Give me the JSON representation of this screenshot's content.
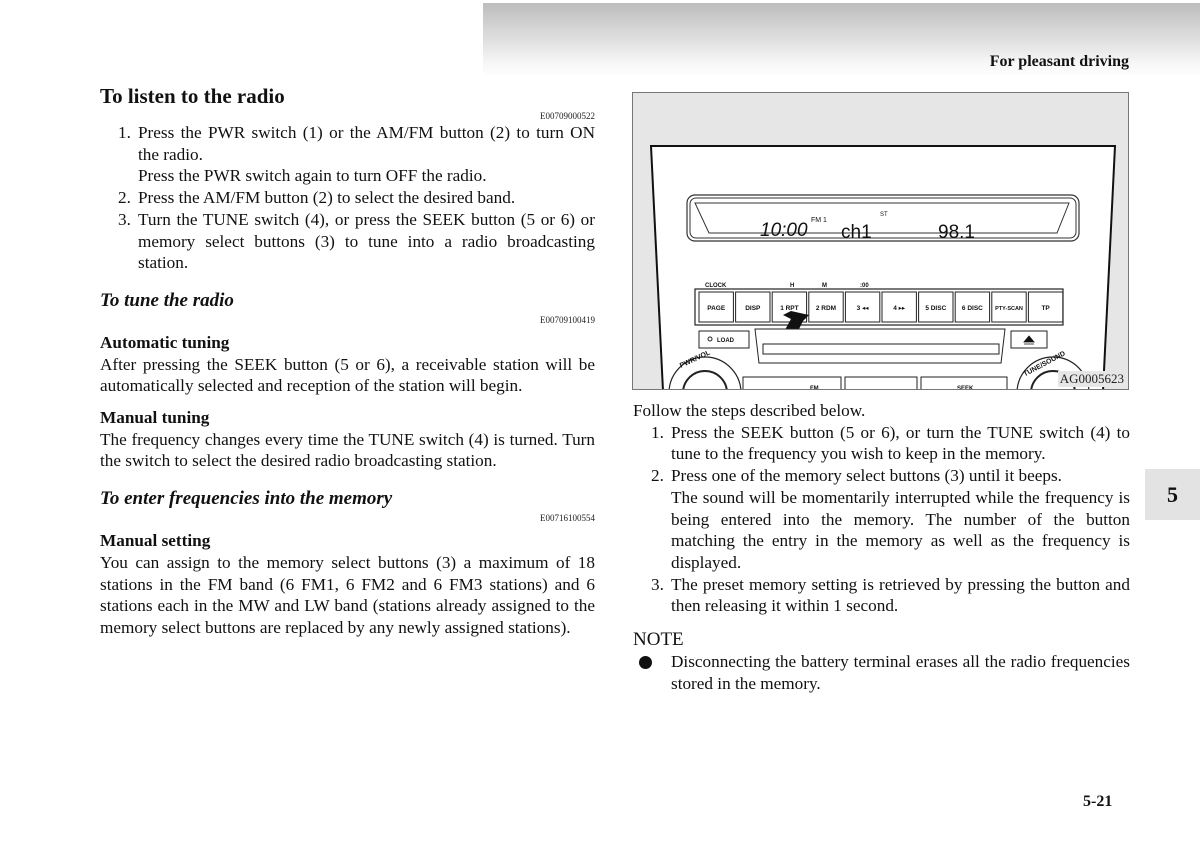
{
  "header": {
    "title": "For pleasant driving"
  },
  "left": {
    "section1": {
      "title": "To listen to the radio",
      "code": "E00709000522",
      "steps": [
        {
          "num": "1.",
          "text": "Press the PWR switch (1) or the AM/FM button (2) to turn ON the radio.",
          "extra": "Press the PWR switch again to turn OFF the radio."
        },
        {
          "num": "2.",
          "text": "Press the AM/FM button (2) to select the desired band."
        },
        {
          "num": "3.",
          "text": "Turn the TUNE switch (4), or press the SEEK button (5 or 6) or memory select buttons (3) to tune into a radio broadcasting station."
        }
      ]
    },
    "section2": {
      "title": "To tune the radio",
      "code": "E00709100419",
      "auto_heading": "Automatic tuning",
      "auto_text": "After pressing the SEEK button (5 or 6), a receivable station will be automatically selected and reception of the station will begin.",
      "manual_heading": "Manual tuning",
      "manual_text": "The frequency changes every time the TUNE switch (4) is turned. Turn the switch to select the desired radio broadcasting station."
    },
    "section3": {
      "title": "To enter frequencies into the memory",
      "code": "E00716100554",
      "heading": "Manual setting",
      "text": "You can assign to the memory select buttons (3) a maximum of 18 stations in the FM band (6 FM1, 6 FM2 and 6 FM3 stations) and 6 stations each in the MW and LW band (stations already assigned to the memory select buttons are replaced by any newly assigned stations)."
    }
  },
  "figure": {
    "code": "AG0005623",
    "display": {
      "clock": "10:00",
      "band": "FM 1",
      "stereo": "ST",
      "channel": "ch1",
      "frequency": "98.1"
    },
    "top_labels": {
      "clock": "CLOCK",
      "hour": "H",
      "minute": "M",
      "zero": ":00"
    },
    "buttons": [
      "PAGE",
      "DISP",
      "1 RPT",
      "2 RDM",
      "3 ◂◂",
      "4 ▸▸",
      "5 DISC",
      "6 DISC",
      "PTY-SCAN",
      "TP"
    ],
    "load_label": "LOAD",
    "eject_icon": "eject-icon",
    "left_knob": "PWR/VOL",
    "right_knob": "TUNE/SOUND",
    "bottom_labels": {
      "fm": "FM",
      "seek": "SEEK"
    }
  },
  "right": {
    "intro": "Follow the steps described below.",
    "steps": [
      {
        "num": "1.",
        "text": "Press the SEEK button (5 or 6), or turn the TUNE switch (4) to tune to the frequency you wish to keep in the memory."
      },
      {
        "num": "2.",
        "text": "Press one of the memory select buttons (3) until it beeps.",
        "extra": "The sound will be momentarily interrupted while the frequency is being entered into the memory. The number of the button matching the entry in the memory as well as the frequency is displayed."
      },
      {
        "num": "3.",
        "text": "The preset memory setting is retrieved by pressing the button and then releasing it within 1 second."
      }
    ],
    "note_title": "NOTE",
    "note_items": [
      "Disconnecting the battery terminal erases all the radio frequencies stored in the memory."
    ]
  },
  "chapter_tab": "5",
  "page_number": "5-21"
}
